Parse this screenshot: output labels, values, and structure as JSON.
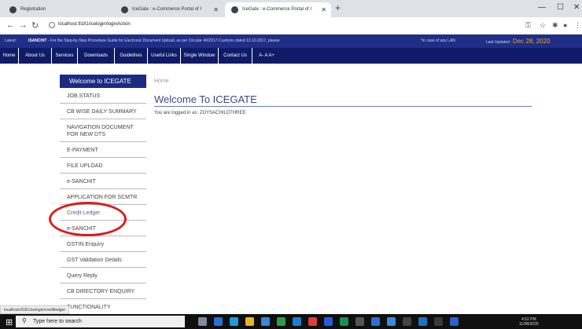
{
  "browser": {
    "tabs": [
      {
        "label": "Registration",
        "active": false
      },
      {
        "label": "IceGate : e-Commerce Portal of I",
        "active": false
      },
      {
        "label": "IceGate : e-Commerce Portal of I",
        "active": true
      }
    ],
    "new_tab_icon": "plus-icon",
    "url": "localhost:8181/icelogin/loginAction",
    "status_url": "localhost:8181/icelogin/creditledger",
    "window_controls": [
      "minimize-icon",
      "maximize-icon",
      "close-icon"
    ]
  },
  "ticker": {
    "latest_label": "Latest:",
    "highlight": "iSANCHIT",
    "message": "- For the Step-by-Step Procedure Guide for Electronic Document Upload, as per Circular 40/2017-Customs dated 13.10.2017, please",
    "message_tail": "*in case of any LAN",
    "updated_label": "Last Updated :",
    "updated_date": "Dec 28, 2020"
  },
  "menu": [
    "Home",
    "About Us",
    "Services",
    "Downloads",
    "Guidelines",
    "Useful Links",
    "Single Window",
    "Contact Us",
    "A-  A  A+"
  ],
  "sidebar": {
    "heading": "Welcome to ICEGATE",
    "items": [
      "JOB STATUS",
      "CB WISE DAILY SUMMARY",
      "NAVIGATION DOCUMENT FOR NEW DTS",
      "E-PAYMENT",
      "FILE UPLOAD",
      "e-SANCHIT",
      "APPLICATION FOR SCMTR",
      "Credit Ledger",
      "e-SANCHIT",
      "GSTIN Enquiry",
      "GST Validation Details",
      "Query Reply",
      "CB DIRECTORY ENQUIRY",
      "FUNCTIONALITY"
    ]
  },
  "main": {
    "breadcrumb": "Home",
    "title": "Welcome To ICEGATE",
    "login_info": "You are logged in as: ZOYSACHILDTHREE"
  },
  "taskbar": {
    "search_placeholder": "Type here to search",
    "time": "4:52 PM",
    "date": "11/08/2020"
  },
  "colors": {
    "ticker_bg": "#1f2e86",
    "menu_bg": "#0f1b66",
    "annotation_circle": "#e01a1a",
    "updated_date": "#e8a33c"
  }
}
